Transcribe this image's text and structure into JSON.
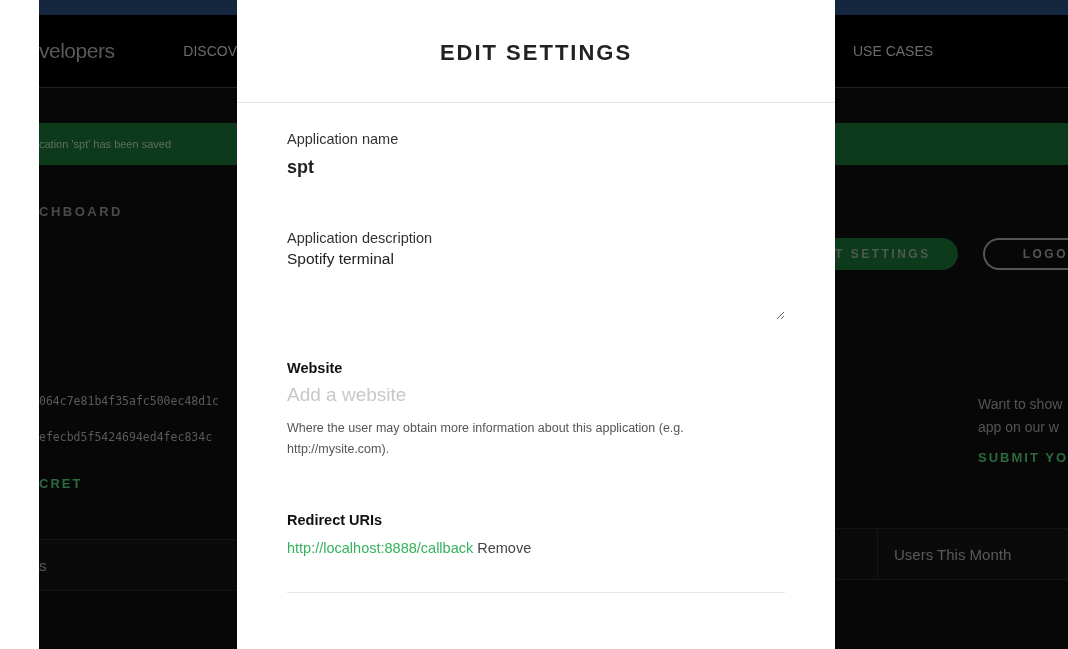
{
  "background": {
    "brand": "velopers",
    "nav": [
      {
        "label": "DISCOV"
      },
      {
        "label": "USE CASES"
      }
    ],
    "toast": "cation 'spt' has been saved",
    "heading": "CHBOARD",
    "client_id": "064c7e81b4f35afc500ec48d1c",
    "client_secret": "efecbd5f5424694ed4fec834c",
    "secret_link": "CRET",
    "edit_button": "T SETTINGS",
    "logout_button": "LOGO",
    "promo_lines": [
      "Want to show",
      "app on our w"
    ],
    "promo_link": "SUBMIT YO",
    "table_columns": [
      "s",
      "Users This Month"
    ]
  },
  "modal": {
    "title": "EDIT SETTINGS",
    "name": {
      "label": "Application name",
      "value": "spt"
    },
    "description": {
      "label": "Application description",
      "value": "Spotify terminal"
    },
    "website": {
      "label": "Website",
      "placeholder": "Add a website",
      "help": "Where the user may obtain more information about this application (e.g. http://mysite.com)."
    },
    "redirects": {
      "label": "Redirect URIs",
      "items": [
        {
          "uri": "http://localhost:8888/callback",
          "action": "Remove"
        }
      ]
    }
  }
}
